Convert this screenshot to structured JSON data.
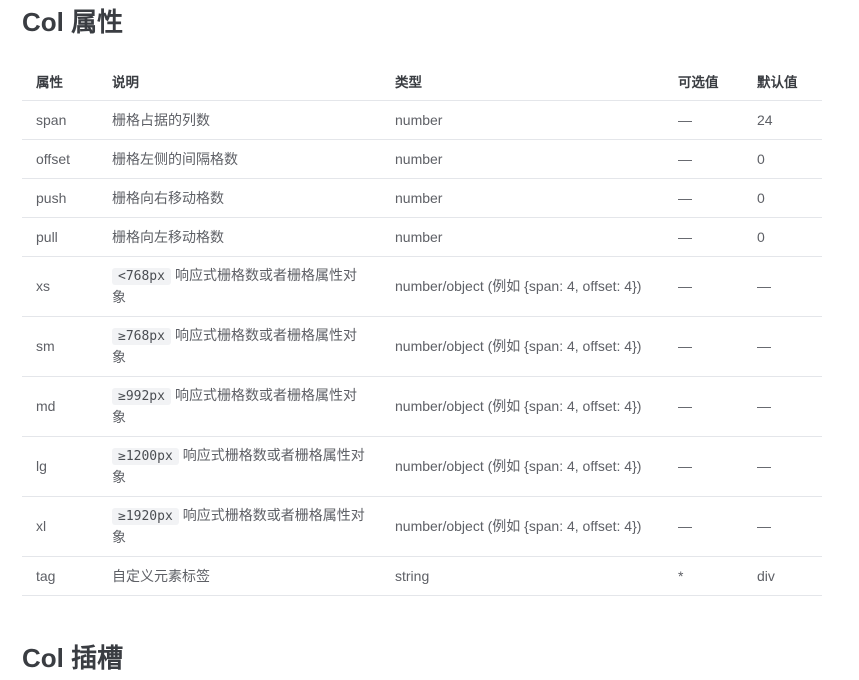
{
  "section_titles": {
    "props": "Col 属性",
    "slots": "Col 插槽"
  },
  "table": {
    "headers": [
      "属性",
      "说明",
      "类型",
      "可选值",
      "默认值"
    ],
    "rows": [
      {
        "attr": "span",
        "code": "",
        "desc": "栅格占据的列数",
        "type": "number",
        "options": "—",
        "default": "24"
      },
      {
        "attr": "offset",
        "code": "",
        "desc": "栅格左侧的间隔格数",
        "type": "number",
        "options": "—",
        "default": "0"
      },
      {
        "attr": "push",
        "code": "",
        "desc": "栅格向右移动格数",
        "type": "number",
        "options": "—",
        "default": "0"
      },
      {
        "attr": "pull",
        "code": "",
        "desc": "栅格向左移动格数",
        "type": "number",
        "options": "—",
        "default": "0"
      },
      {
        "attr": "xs",
        "code": "<768px",
        "desc": "响应式栅格数或者栅格属性对象",
        "type": "number/object (例如 {span: 4, offset: 4})",
        "options": "—",
        "default": "—"
      },
      {
        "attr": "sm",
        "code": "≥768px",
        "desc": "响应式栅格数或者栅格属性对象",
        "type": "number/object (例如 {span: 4, offset: 4})",
        "options": "—",
        "default": "—"
      },
      {
        "attr": "md",
        "code": "≥992px",
        "desc": "响应式栅格数或者栅格属性对象",
        "type": "number/object (例如 {span: 4, offset: 4})",
        "options": "—",
        "default": "—"
      },
      {
        "attr": "lg",
        "code": "≥1200px",
        "desc": "响应式栅格数或者栅格属性对象",
        "type": "number/object (例如 {span: 4, offset: 4})",
        "options": "—",
        "default": "—"
      },
      {
        "attr": "xl",
        "code": "≥1920px",
        "desc": "响应式栅格数或者栅格属性对象",
        "type": "number/object (例如 {span: 4, offset: 4})",
        "options": "—",
        "default": "—"
      },
      {
        "attr": "tag",
        "code": "",
        "desc": "自定义元素标签",
        "type": "string",
        "options": "*",
        "default": "div"
      }
    ]
  }
}
